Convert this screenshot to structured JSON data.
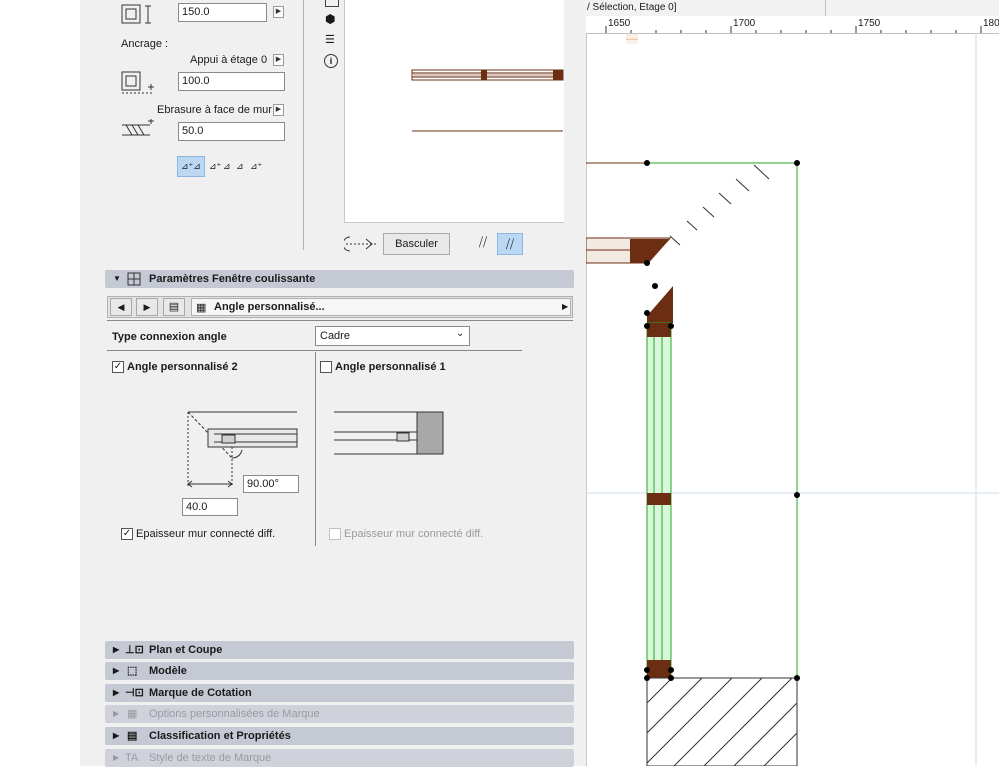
{
  "panel": {
    "height_value": "150.0",
    "anchor_label": "Ancrage :",
    "anchor_select": "Appui à étage 0",
    "anchor_value": "100.0",
    "reveal_select": "Ebrasure à face de mur",
    "reveal_value": "50.0",
    "flip_button": "Basculer",
    "section_title": "Paramètres Fenêtre coulissante",
    "page_selector": "Angle personnalisé...",
    "corner_type_label": "Type connexion angle",
    "corner_type_value": "Cadre",
    "custom_angle_2": {
      "label": "Angle personnalisé 2",
      "checked": true
    },
    "custom_angle_1": {
      "label": "Angle personnalisé 1",
      "checked": false
    },
    "angle_value": "90.00°",
    "length_value": "40.0",
    "thickness_left": {
      "label": "Epaisseur mur connecté diff.",
      "checked": true
    },
    "thickness_right": {
      "label": "Epaisseur mur connecté diff.",
      "checked": false,
      "disabled": true
    },
    "sections": [
      {
        "label": "Plan et Coupe",
        "icon": "plan-section-icon",
        "disabled": false
      },
      {
        "label": "Modèle",
        "icon": "model-icon",
        "disabled": false
      },
      {
        "label": "Marque de Cotation",
        "icon": "dimension-marker-icon",
        "disabled": false
      },
      {
        "label": "Options personnalisées de Marque",
        "icon": "marker-options-icon",
        "disabled": true
      },
      {
        "label": "Classification et Propriétés",
        "icon": "classification-icon",
        "disabled": false
      },
      {
        "label": "Style de texte de Marque",
        "icon": "text-style-icon",
        "disabled": true
      }
    ]
  },
  "drawing": {
    "header": "/ Sélection, Etage 0]",
    "ruler": [
      "1650",
      "1700",
      "1750",
      "180"
    ],
    "dashed_tag": "----"
  },
  "colors": {
    "wall_brown": "#6b2e12",
    "selection_green": "#22aa22",
    "section_bar": "#c5c9d4",
    "active_toggle": "#bcd7f3"
  }
}
